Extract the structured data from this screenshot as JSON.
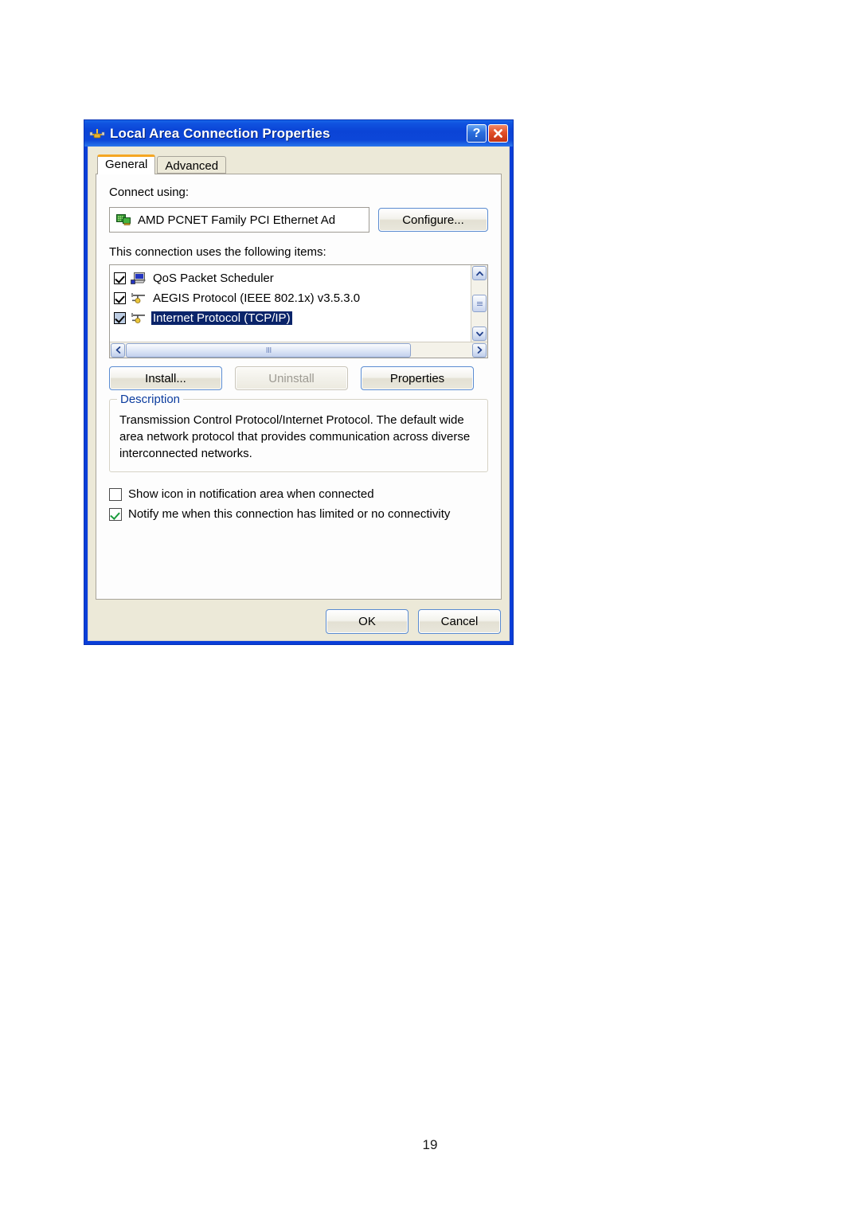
{
  "page": {
    "number": "19",
    "background_color": "#ffffff"
  },
  "window": {
    "title": "Local Area Connection Properties",
    "title_icon": "network-connection-icon",
    "title_bar_color": "#0b44d6",
    "client_color": "#ece9d8",
    "buttons": {
      "help_label": "?",
      "help_icon": "question-mark-icon",
      "close_icon": "close-x-icon"
    }
  },
  "tabs": [
    {
      "label": "General",
      "active": true
    },
    {
      "label": "Advanced",
      "active": false
    }
  ],
  "general": {
    "connect_using_label": "Connect using:",
    "adapter": {
      "name": "AMD PCNET Family PCI Ethernet Ad",
      "icon": "network-adapter-icon"
    },
    "configure_label": "Configure...",
    "items_label": "This connection uses the following items:",
    "items": [
      {
        "label": "QoS Packet Scheduler",
        "checked": true,
        "selected": false,
        "icon": "computer-icon"
      },
      {
        "label": "AEGIS Protocol (IEEE 802.1x) v3.5.3.0",
        "checked": true,
        "selected": false,
        "icon": "protocol-icon"
      },
      {
        "label": "Internet Protocol (TCP/IP)",
        "checked": true,
        "selected": true,
        "icon": "protocol-icon"
      }
    ],
    "selection_color": "#0a246a",
    "buttons": {
      "install_label": "Install...",
      "uninstall_label": "Uninstall",
      "uninstall_disabled": true,
      "properties_label": "Properties"
    },
    "description": {
      "title": "Description",
      "title_color": "#0b3c9e",
      "text": "Transmission Control Protocol/Internet Protocol. The default wide area network protocol that provides communication across diverse interconnected networks."
    },
    "options": [
      {
        "label": "Show icon in notification area when connected",
        "checked": false
      },
      {
        "label": "Notify me when this connection has limited or no connectivity",
        "checked": true
      }
    ],
    "check_color": "#1a9b3c"
  },
  "footer": {
    "ok_label": "OK",
    "cancel_label": "Cancel"
  }
}
